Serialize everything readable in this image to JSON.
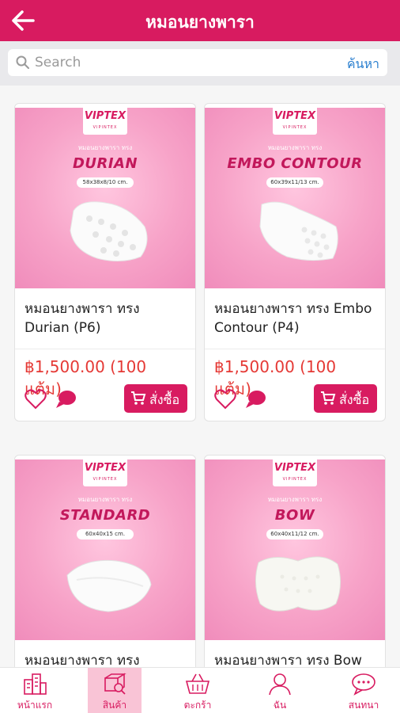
{
  "header": {
    "title": "หมอนยางพารา",
    "back_icon": "back-arrow-icon"
  },
  "search": {
    "placeholder": "Search",
    "value": "",
    "button_label": "ค้นหา"
  },
  "colors": {
    "brand": "#d81b60",
    "price": "#e53935",
    "link": "#2a7fcf"
  },
  "products": [
    {
      "name": "หมอนยางพารา ทรง Durian (P6)",
      "price": "฿1,500.00 (100 แต้ม)",
      "image": {
        "logo": "VIPTEX",
        "logo_sub": "VIPINTEX",
        "caption": "หมอนยางพารา ทรง",
        "model": "DURIAN",
        "size": "58x38x8/10 cm."
      },
      "buy_label": "สั่งซื้อ"
    },
    {
      "name": "หมอนยางพารา ทรง Embo Contour (P4)",
      "price": "฿1,500.00 (100 แต้ม)",
      "image": {
        "logo": "VIPTEX",
        "logo_sub": "VIPINTEX",
        "caption": "หมอนยางพารา ทรง",
        "model": "EMBO CONTOUR",
        "size": "60x39x11/13 cm."
      },
      "buy_label": "สั่งซื้อ"
    },
    {
      "name": "หมอนยางพารา ทรง Standard",
      "price": "",
      "image": {
        "logo": "VIPTEX",
        "logo_sub": "VIPINTEX",
        "caption": "หมอนยางพารา ทรง",
        "model": "STANDARD",
        "size": "60x40x15 cm."
      },
      "buy_label": ""
    },
    {
      "name": "หมอนยางพารา ทรง Bow",
      "price": "",
      "image": {
        "logo": "VIPTEX",
        "logo_sub": "VIPINTEX",
        "caption": "หมอนยางพารา ทรง",
        "model": "BOW",
        "size": "60x40x11/12 cm."
      },
      "buy_label": ""
    }
  ],
  "bottom_nav": [
    {
      "label": "หน้าแรก",
      "icon": "buildings-icon",
      "active": false
    },
    {
      "label": "สินค้า",
      "icon": "products-icon",
      "active": true
    },
    {
      "label": "ตะกร้า",
      "icon": "basket-icon",
      "active": false
    },
    {
      "label": "ฉัน",
      "icon": "user-icon",
      "active": false
    },
    {
      "label": "สนทนา",
      "icon": "chat-icon",
      "active": false
    }
  ]
}
